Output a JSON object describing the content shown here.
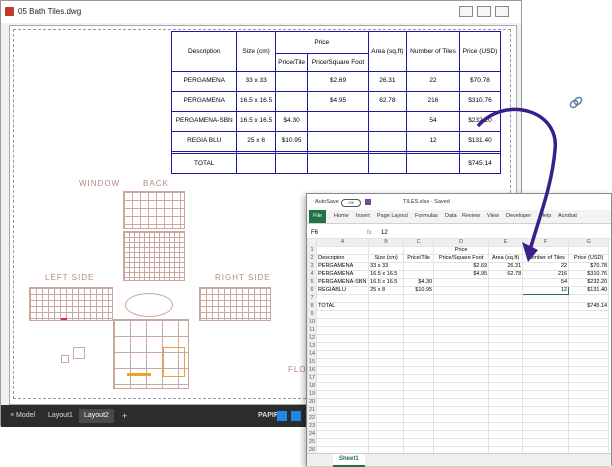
{
  "cad": {
    "title": "05 Bath Tiles.dwg",
    "table": {
      "headers": {
        "description": "Description",
        "size": "Size (cm)",
        "price": "Price",
        "area": "Area (sq.ft)",
        "num_tiles": "Number of Tiles",
        "price_usd": "Price (USD)",
        "price_tile": "Price/Tile",
        "price_sqft": "Price/Square Foot"
      },
      "rows": [
        {
          "desc": "PERGAMENA",
          "size": "33 x 33",
          "ptile": "",
          "psqft": "$2.69",
          "area": "26.31",
          "num": "22",
          "usd": "$70.78"
        },
        {
          "desc": "PERGAMENA",
          "size": "16.5 x 16.5",
          "ptile": "",
          "psqft": "$4.95",
          "area": "62.78",
          "num": "216",
          "usd": "$310.76"
        },
        {
          "desc": "PERGAMENA-SBN",
          "size": "16.5 x 16.5",
          "ptile": "$4.30",
          "psqft": "",
          "area": "",
          "num": "54",
          "usd": "$232.20"
        },
        {
          "desc": "REGIA BLU",
          "size": "25 x 8",
          "ptile": "$10.95",
          "psqft": "",
          "area": "",
          "num": "12",
          "usd": "$131.40"
        }
      ],
      "total_label": "TOTAL",
      "total_value": "$745.14"
    },
    "labels": {
      "window": "WINDOW",
      "back": "BACK",
      "left_side": "LEFT SIDE",
      "right_side": "RIGHT SIDE",
      "floor": "FLO"
    },
    "tabs": {
      "model": "Model",
      "layout1": "Layout1",
      "layout2": "Layout2",
      "add": "+"
    },
    "status": {
      "papir": "PAPIR"
    }
  },
  "excel": {
    "autosave": "AutoSave",
    "autosave_state": "Off",
    "title": "TILES.xlsx - Saved",
    "ribbon": [
      "File",
      "Home",
      "Insert",
      "Page Layout",
      "Formulas",
      "Data",
      "Review",
      "View",
      "Developer",
      "Help",
      "Acrobat"
    ],
    "cell_ref": "F6",
    "formula": "12",
    "columns": [
      "A",
      "B",
      "C",
      "D",
      "E",
      "F",
      "G"
    ],
    "row_numbers": [
      "1",
      "2",
      "3",
      "4",
      "5",
      "6",
      "7",
      "8",
      "9",
      "10",
      "11",
      "12",
      "13",
      "14",
      "15",
      "16",
      "17",
      "18",
      "19",
      "20",
      "21",
      "22",
      "23",
      "24",
      "25",
      "26",
      "27"
    ],
    "rows": [
      [
        "",
        "",
        "",
        "Price",
        "",
        "",
        ""
      ],
      [
        "Descripton",
        "Size (cm)",
        "Price/Tile",
        "Price/Square Foot",
        "Area (sq.ft)",
        "Number of Tiles",
        "Price (USD)"
      ],
      [
        "PERGAMENA",
        "33 x 33",
        "",
        "$2.69",
        "26.31",
        "22",
        "$70.78"
      ],
      [
        "PERGAMENA",
        "16.5 x 16.5",
        "",
        "$4.95",
        "62.78",
        "216",
        "$310.76"
      ],
      [
        "PERGAMENA-SBN",
        "16.5 x 16.5",
        "$4.30",
        "",
        "",
        "54",
        "$232.20"
      ],
      [
        "REGIABLU",
        "25 x 8",
        "$10.95",
        "",
        "",
        "12",
        "$131.40"
      ],
      [
        "",
        "",
        "",
        "",
        "",
        "",
        ""
      ],
      [
        "TOTAL",
        "",
        "",
        "",
        "",
        "",
        "$745.14"
      ]
    ],
    "sheet_tab": "Sheet1"
  },
  "colors": {
    "cad_table_border": "#1a1aa0",
    "excel_green": "#217346",
    "arrow": "#3a1e8a"
  }
}
